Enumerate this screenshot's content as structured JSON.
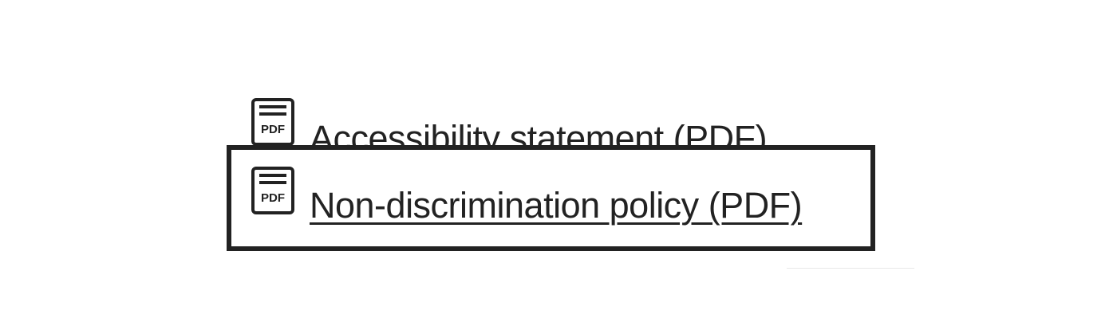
{
  "links": [
    {
      "icon_label": "PDF",
      "label": "Accessibility statement (PDF)"
    },
    {
      "icon_label": "PDF",
      "label": "Non-discrimination policy (PDF)",
      "focused": true
    }
  ],
  "colors": {
    "text": "#222222",
    "focus_outline": "#222222",
    "background": "#ffffff"
  }
}
